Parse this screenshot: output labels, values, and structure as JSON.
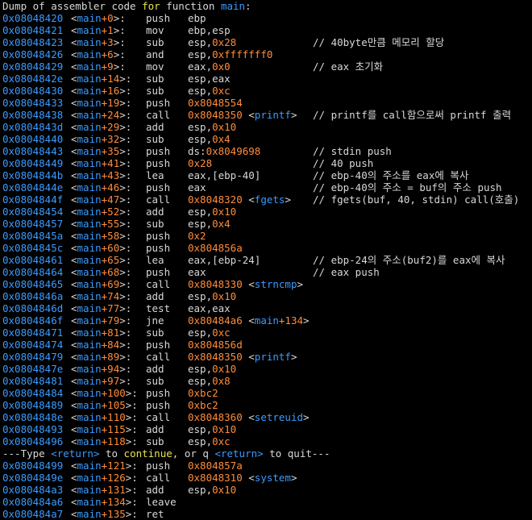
{
  "header": {
    "prefix": "Dump of assembler code ",
    "keyword": "for",
    "middle": " function ",
    "func": "main",
    "suffix": ":"
  },
  "pager": {
    "p1": "---Type ",
    "k1": "<return>",
    "p2": " to ",
    "k2": "continue",
    "p3": ", or q ",
    "k3": "<return>",
    "p4": " to quit---"
  },
  "lines": [
    {
      "addr": "0x08048420",
      "off": "+0",
      "mn": "push",
      "op": [
        [
          "ebp",
          "t"
        ]
      ],
      "cm": ""
    },
    {
      "addr": "0x08048421",
      "off": "+1",
      "mn": "mov",
      "op": [
        [
          "ebp,esp",
          "t"
        ]
      ],
      "cm": ""
    },
    {
      "addr": "0x08048423",
      "off": "+3",
      "mn": "sub",
      "op": [
        [
          "esp,",
          "t"
        ],
        [
          "0x28",
          "n"
        ]
      ],
      "cm": "// 40byte만큼 메모리 할당"
    },
    {
      "addr": "0x08048426",
      "off": "+6",
      "mn": "and",
      "op": [
        [
          "esp,",
          "t"
        ],
        [
          "0xfffffff0",
          "n"
        ]
      ],
      "cm": ""
    },
    {
      "addr": "0x08048429",
      "off": "+9",
      "mn": "mov",
      "op": [
        [
          "eax,",
          "t"
        ],
        [
          "0x0",
          "n"
        ]
      ],
      "cm": "// eax 초기화"
    },
    {
      "addr": "0x0804842e",
      "off": "+14",
      "mn": "sub",
      "op": [
        [
          "esp,eax",
          "t"
        ]
      ],
      "cm": ""
    },
    {
      "addr": "0x08048430",
      "off": "+16",
      "mn": "sub",
      "op": [
        [
          "esp,",
          "t"
        ],
        [
          "0xc",
          "n"
        ]
      ],
      "cm": ""
    },
    {
      "addr": "0x08048433",
      "off": "+19",
      "mn": "push",
      "op": [
        [
          "0x8048554",
          "n"
        ]
      ],
      "cm": ""
    },
    {
      "addr": "0x08048438",
      "off": "+24",
      "mn": "call",
      "op": [
        [
          "0x8048350",
          "n"
        ],
        [
          " <",
          "t"
        ],
        [
          "printf",
          "f"
        ],
        [
          ">",
          "t"
        ]
      ],
      "cm": "// printf를 call함으로써 printf 출력"
    },
    {
      "addr": "0x0804843d",
      "off": "+29",
      "mn": "add",
      "op": [
        [
          "esp,",
          "t"
        ],
        [
          "0x10",
          "n"
        ]
      ],
      "cm": ""
    },
    {
      "addr": "0x08048440",
      "off": "+32",
      "mn": "sub",
      "op": [
        [
          "esp,",
          "t"
        ],
        [
          "0x4",
          "n"
        ]
      ],
      "cm": ""
    },
    {
      "addr": "0x08048443",
      "off": "+35",
      "mn": "push",
      "op": [
        [
          "ds:",
          "t"
        ],
        [
          "0x8049698",
          "n"
        ]
      ],
      "cm": "// stdin push"
    },
    {
      "addr": "0x08048449",
      "off": "+41",
      "mn": "push",
      "op": [
        [
          "0x28",
          "n"
        ]
      ],
      "cm": "// 40 push"
    },
    {
      "addr": "0x0804844b",
      "off": "+43",
      "mn": "lea",
      "op": [
        [
          "eax,[ebp-40]",
          "t"
        ]
      ],
      "cm": "// ebp-40의 주소를 eax에 복사"
    },
    {
      "addr": "0x0804844e",
      "off": "+46",
      "mn": "push",
      "op": [
        [
          "eax",
          "t"
        ]
      ],
      "cm": "// ebp-40의 주소 = buf의 주소 push"
    },
    {
      "addr": "0x0804844f",
      "off": "+47",
      "mn": "call",
      "op": [
        [
          "0x8048320",
          "n"
        ],
        [
          " <",
          "t"
        ],
        [
          "fgets",
          "f"
        ],
        [
          ">",
          "t"
        ]
      ],
      "cm": "// fgets(buf, 40, stdin) call(호출)"
    },
    {
      "addr": "0x08048454",
      "off": "+52",
      "mn": "add",
      "op": [
        [
          "esp,",
          "t"
        ],
        [
          "0x10",
          "n"
        ]
      ],
      "cm": ""
    },
    {
      "addr": "0x08048457",
      "off": "+55",
      "mn": "sub",
      "op": [
        [
          "esp,",
          "t"
        ],
        [
          "0x4",
          "n"
        ]
      ],
      "cm": ""
    },
    {
      "addr": "0x0804845a",
      "off": "+58",
      "mn": "push",
      "op": [
        [
          "0x2",
          "n"
        ]
      ],
      "cm": ""
    },
    {
      "addr": "0x0804845c",
      "off": "+60",
      "mn": "push",
      "op": [
        [
          "0x804856a",
          "n"
        ]
      ],
      "cm": ""
    },
    {
      "addr": "0x08048461",
      "off": "+65",
      "mn": "lea",
      "op": [
        [
          "eax,[ebp-24]",
          "t"
        ]
      ],
      "cm": "// ebp-24의 주소(buf2)를 eax에 복사"
    },
    {
      "addr": "0x08048464",
      "off": "+68",
      "mn": "push",
      "op": [
        [
          "eax",
          "t"
        ]
      ],
      "cm": "// eax push"
    },
    {
      "addr": "0x08048465",
      "off": "+69",
      "mn": "call",
      "op": [
        [
          "0x8048330",
          "n"
        ],
        [
          " <",
          "t"
        ],
        [
          "strncmp",
          "f"
        ],
        [
          ">",
          "t"
        ]
      ],
      "cm": ""
    },
    {
      "addr": "0x0804846a",
      "off": "+74",
      "mn": "add",
      "op": [
        [
          "esp,",
          "t"
        ],
        [
          "0x10",
          "n"
        ]
      ],
      "cm": ""
    },
    {
      "addr": "0x0804846d",
      "off": "+77",
      "mn": "test",
      "op": [
        [
          "eax,eax",
          "t"
        ]
      ],
      "cm": ""
    },
    {
      "addr": "0x0804846f",
      "off": "+79",
      "mn": "jne",
      "op": [
        [
          "0x80484a6",
          "n"
        ],
        [
          " <",
          "t"
        ],
        [
          "main",
          "f"
        ],
        [
          "+134",
          "n"
        ],
        [
          ">",
          "t"
        ]
      ],
      "cm": ""
    },
    {
      "addr": "0x08048471",
      "off": "+81",
      "mn": "sub",
      "op": [
        [
          "esp,",
          "t"
        ],
        [
          "0xc",
          "n"
        ]
      ],
      "cm": ""
    },
    {
      "addr": "0x08048474",
      "off": "+84",
      "mn": "push",
      "op": [
        [
          "0x804856d",
          "n"
        ]
      ],
      "cm": ""
    },
    {
      "addr": "0x08048479",
      "off": "+89",
      "mn": "call",
      "op": [
        [
          "0x8048350",
          "n"
        ],
        [
          " <",
          "t"
        ],
        [
          "printf",
          "f"
        ],
        [
          ">",
          "t"
        ]
      ],
      "cm": ""
    },
    {
      "addr": "0x0804847e",
      "off": "+94",
      "mn": "add",
      "op": [
        [
          "esp,",
          "t"
        ],
        [
          "0x10",
          "n"
        ]
      ],
      "cm": ""
    },
    {
      "addr": "0x08048481",
      "off": "+97",
      "mn": "sub",
      "op": [
        [
          "esp,",
          "t"
        ],
        [
          "0x8",
          "n"
        ]
      ],
      "cm": ""
    },
    {
      "addr": "0x08048484",
      "off": "+100",
      "mn": "push",
      "op": [
        [
          "0xbc2",
          "n"
        ]
      ],
      "cm": ""
    },
    {
      "addr": "0x08048489",
      "off": "+105",
      "mn": "push",
      "op": [
        [
          "0xbc2",
          "n"
        ]
      ],
      "cm": ""
    },
    {
      "addr": "0x0804848e",
      "off": "+110",
      "mn": "call",
      "op": [
        [
          "0x8048360",
          "n"
        ],
        [
          " <",
          "t"
        ],
        [
          "setreuid",
          "f"
        ],
        [
          ">",
          "t"
        ]
      ],
      "cm": ""
    },
    {
      "addr": "0x08048493",
      "off": "+115",
      "mn": "add",
      "op": [
        [
          "esp,",
          "t"
        ],
        [
          "0x10",
          "n"
        ]
      ],
      "cm": ""
    },
    {
      "addr": "0x08048496",
      "off": "+118",
      "mn": "sub",
      "op": [
        [
          "esp,",
          "t"
        ],
        [
          "0xc",
          "n"
        ]
      ],
      "cm": ""
    },
    {
      "pager": true
    },
    {
      "addr": "0x08048499",
      "off": "+121",
      "mn": "push",
      "op": [
        [
          "0x804857a",
          "n"
        ]
      ],
      "cm": ""
    },
    {
      "addr": "0x0804849e",
      "off": "+126",
      "mn": "call",
      "op": [
        [
          "0x8048310",
          "n"
        ],
        [
          " <",
          "t"
        ],
        [
          "system",
          "f"
        ],
        [
          ">",
          "t"
        ]
      ],
      "cm": ""
    },
    {
      "addr": "0x080484a3",
      "off": "+131",
      "mn": "add",
      "op": [
        [
          "esp,",
          "t"
        ],
        [
          "0x10",
          "n"
        ]
      ],
      "cm": ""
    },
    {
      "addr": "0x080484a6",
      "off": "+134",
      "mn": "leave",
      "op": [],
      "cm": ""
    },
    {
      "addr": "0x080484a7",
      "off": "+135",
      "mn": "ret",
      "op": [],
      "cm": ""
    }
  ],
  "sym": {
    "open": "<",
    "func": "main",
    "close": ">:"
  },
  "colors": {
    "address": "#3b9bff",
    "number": "#ff8c3a",
    "keyword": "#e8e34f",
    "text": "#d8d8d8",
    "background": "#000000"
  }
}
